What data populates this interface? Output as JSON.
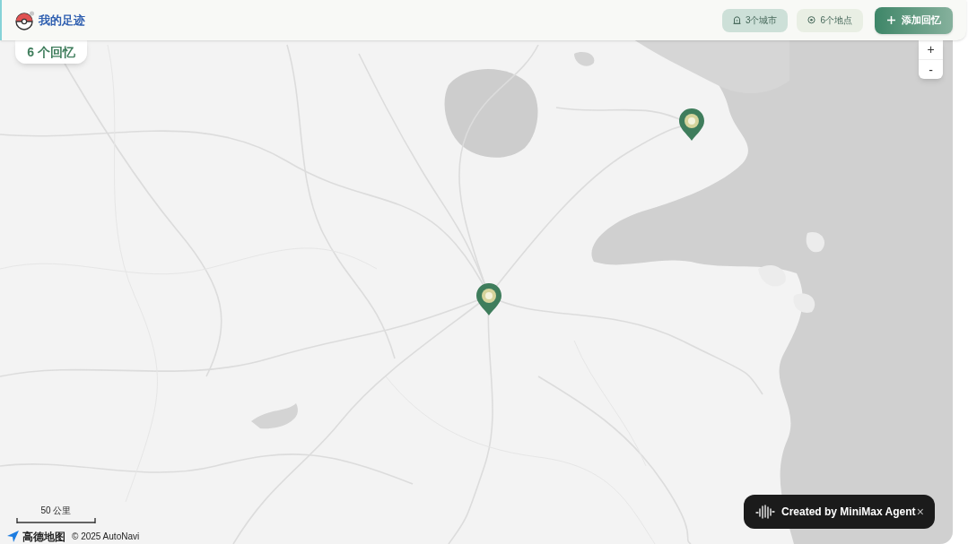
{
  "header": {
    "title": "我的足迹",
    "stats": [
      {
        "kind": "cities",
        "label": "3个城市",
        "hovered": true
      },
      {
        "kind": "places",
        "label": "6个地点",
        "hovered": false
      }
    ],
    "add_button": {
      "label": "添加回忆"
    }
  },
  "map": {
    "memory_count": "6 个回忆",
    "zoom_controls": [
      "+",
      "-"
    ],
    "markers": [
      {
        "kind": "memory"
      },
      {
        "kind": "memory"
      }
    ],
    "scale_bar": {
      "label": "50 公里"
    },
    "attribution": {
      "logo": "高德地图",
      "copyright": "© 2025 AutoNavi"
    }
  },
  "credit_badge": {
    "text": "Created by MiniMax Agent",
    "close": "×"
  }
}
